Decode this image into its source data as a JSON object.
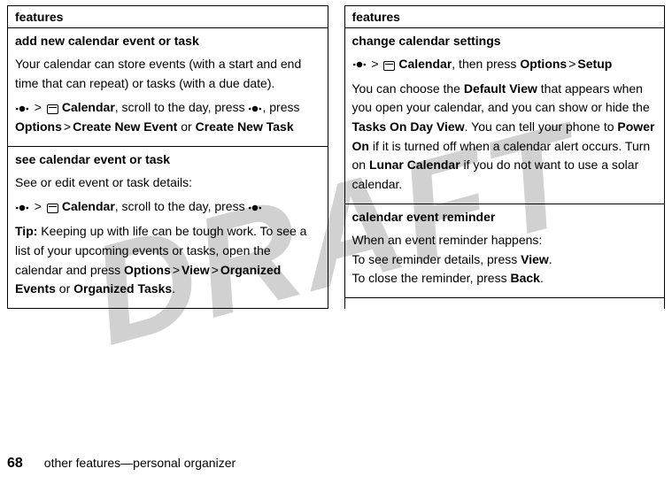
{
  "watermark": "DRAFT",
  "left": {
    "header": "features",
    "sections": [
      {
        "title": "add new calendar event or task",
        "desc": "Your calendar can store events (with a start and end time that can repeat) or tasks (with a due date).",
        "path": {
          "gt1": ">",
          "calendar": "Calendar",
          "mid1": ", scroll to the day, press ",
          "mid2": ", press ",
          "options": "Options",
          "gt2": ">",
          "cne": "Create New Event",
          "or": " or ",
          "cnt": "Create New Task"
        }
      },
      {
        "title": "see calendar event or task",
        "desc": "See or edit event or task details:",
        "path": {
          "gt1": ">",
          "calendar": "Calendar",
          "mid1": ", scroll to the day, press "
        },
        "tipLabel": "Tip:",
        "tipText": " Keeping up with life can be tough work. To see a list of your upcoming events or tasks, open the calendar and press ",
        "tipOptions": "Options",
        "gt2": ">",
        "tipView": "View",
        "gt3": ">",
        "tipOE": "Organized Events",
        "or": " or ",
        "tipOT": "Organized Tasks",
        "period": "."
      }
    ]
  },
  "right": {
    "header": "features",
    "sections": [
      {
        "title": "change calendar settings",
        "path": {
          "gt1": ">",
          "calendar": "Calendar",
          "then": ", then press ",
          "options": "Options",
          "gt2": ">",
          "setup": "Setup"
        },
        "body1a": "You can choose the ",
        "defaultView": "Default View",
        "body1b": " that appears when you open your calendar, and you can show or hide the ",
        "tasksOnDay": "Tasks On Day View",
        "body1c": ". You can tell your phone to ",
        "powerOn": "Power On",
        "body1d": " if it is turned off when a calendar alert occurs. Turn on ",
        "lunar": "Lunar Calendar",
        "body1e": " if you do not want to use a solar calendar."
      },
      {
        "title": "calendar event reminder",
        "line1": "When an event reminder happens:",
        "line2a": "To see reminder details, press ",
        "view": "View",
        "line2b": ".",
        "line3a": "To close the reminder, press ",
        "back": "Back",
        "line3b": "."
      }
    ]
  },
  "footer": {
    "pageno": "68",
    "text": "other features—personal organizer"
  }
}
